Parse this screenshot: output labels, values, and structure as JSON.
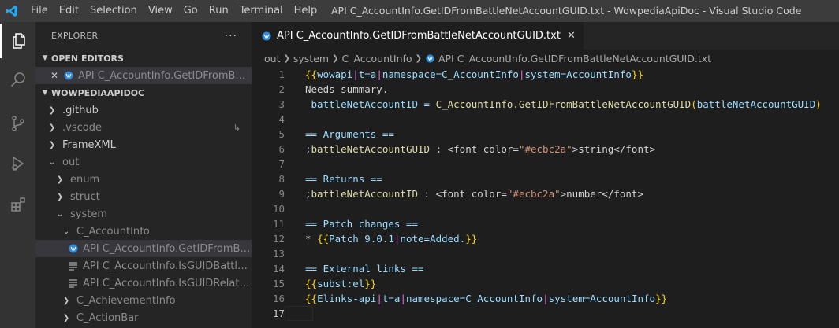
{
  "window": {
    "title": "API C_AccountInfo.GetIDFromBattleNetAccountGUID.txt - WowpediaApiDoc - Visual Studio Code",
    "accent_color": "#0098ff"
  },
  "menu": [
    "File",
    "Edit",
    "Selection",
    "View",
    "Go",
    "Run",
    "Terminal",
    "Help"
  ],
  "activity_bar": [
    {
      "name": "files-icon",
      "active": true
    },
    {
      "name": "search-icon",
      "active": false
    },
    {
      "name": "source-control-icon",
      "active": false
    },
    {
      "name": "run-debug-icon",
      "active": false
    },
    {
      "name": "extensions-icon",
      "active": false
    }
  ],
  "sidebar": {
    "title": "EXPLORER",
    "more": "···",
    "open_editors": {
      "label": "OPEN EDITORS",
      "items": [
        {
          "label": "API C_AccountInfo.GetIDFromBattleNetAccountGUID.txt",
          "icon": "wow-file-icon"
        }
      ]
    },
    "workspace": {
      "label": "WOWPEDIAAPIDOC",
      "tree": [
        {
          "label": ".github",
          "depth": 0,
          "twisty": "closed",
          "dim": false
        },
        {
          "label": ".vscode",
          "depth": 0,
          "twisty": "closed",
          "dim": true,
          "badge": "↳"
        },
        {
          "label": "FrameXML",
          "depth": 0,
          "twisty": "closed",
          "dim": false
        },
        {
          "label": "out",
          "depth": 0,
          "twisty": "open",
          "dim": true
        },
        {
          "label": "enum",
          "depth": 1,
          "twisty": "closed",
          "dim": true
        },
        {
          "label": "struct",
          "depth": 1,
          "twisty": "closed",
          "dim": true
        },
        {
          "label": "system",
          "depth": 1,
          "twisty": "open",
          "dim": true
        },
        {
          "label": "C_AccountInfo",
          "depth": 2,
          "twisty": "open",
          "dim": true
        },
        {
          "label": "API C_AccountInfo.GetIDFromBattleNetAccountGUID.txt",
          "depth": 3,
          "twisty": "none",
          "dim": true,
          "selected": true,
          "icon": "wow-file-icon"
        },
        {
          "label": "API C_AccountInfo.IsGUIDBattleNetAccountType.txt",
          "depth": 3,
          "twisty": "none",
          "dim": true,
          "icon": "text-file-icon"
        },
        {
          "label": "API C_AccountInfo.IsGUIDRelatedToLocalAccount.txt",
          "depth": 3,
          "twisty": "none",
          "dim": true,
          "icon": "text-file-icon"
        },
        {
          "label": "C_AchievementInfo",
          "depth": 2,
          "twisty": "closed",
          "dim": true
        },
        {
          "label": "C_ActionBar",
          "depth": 2,
          "twisty": "closed",
          "dim": true
        }
      ]
    }
  },
  "editor": {
    "tab": {
      "label": "API C_AccountInfo.GetIDFromBattleNetAccountGUID.txt",
      "close": "✕"
    },
    "breadcrumb": [
      "out",
      "system",
      "C_AccountInfo",
      "API C_AccountInfo.GetIDFromBattleNetAccountGUID.txt"
    ],
    "lines": [
      {
        "n": "1",
        "tokens": [
          [
            "{{",
            "c-brace-y"
          ],
          [
            "wowapi",
            "c-tpl"
          ],
          [
            "|",
            "c-brace-p"
          ],
          [
            "t=a",
            "c-tpl"
          ],
          [
            "|",
            "c-brace-p"
          ],
          [
            "namespace=C_AccountInfo",
            "c-tpl"
          ],
          [
            "|",
            "c-brace-p"
          ],
          [
            "system=AccountInfo",
            "c-tpl"
          ],
          [
            "}}",
            "c-brace-y"
          ]
        ]
      },
      {
        "n": "2",
        "tokens": [
          [
            "Needs summary.",
            "c-text"
          ]
        ]
      },
      {
        "n": "3",
        "tokens": [
          [
            " battleNetAccountID = ",
            "c-tpl"
          ],
          [
            "C_AccountInfo.GetIDFromBattleNetAccountGUID",
            "c-fn"
          ],
          [
            "(",
            "c-brace-y"
          ],
          [
            "battleNetAccountGUID",
            "c-tpl"
          ],
          [
            ")",
            "c-brace-y"
          ]
        ]
      },
      {
        "n": "4",
        "tokens": [
          [
            " ",
            "c-text"
          ]
        ]
      },
      {
        "n": "5",
        "tokens": [
          [
            "== Arguments ==",
            "c-tpl"
          ]
        ]
      },
      {
        "n": "6",
        "tokens": [
          [
            ";",
            "c-text"
          ],
          [
            "battleNetAccountGUID",
            "c-fn"
          ],
          [
            " : ",
            "c-text"
          ],
          [
            "<font color=",
            "c-text"
          ],
          [
            "\"#ecbc2a\"",
            "c-str"
          ],
          [
            ">string</font>",
            "c-text"
          ]
        ]
      },
      {
        "n": "7",
        "tokens": [
          [
            " ",
            "c-text"
          ]
        ]
      },
      {
        "n": "8",
        "tokens": [
          [
            "== Returns ==",
            "c-tpl"
          ]
        ]
      },
      {
        "n": "9",
        "tokens": [
          [
            ";",
            "c-text"
          ],
          [
            "battleNetAccountID",
            "c-fn"
          ],
          [
            " : ",
            "c-text"
          ],
          [
            "<font color=",
            "c-text"
          ],
          [
            "\"#ecbc2a\"",
            "c-str"
          ],
          [
            ">number</font>",
            "c-text"
          ]
        ]
      },
      {
        "n": "10",
        "tokens": [
          [
            " ",
            "c-text"
          ]
        ]
      },
      {
        "n": "11",
        "tokens": [
          [
            "== Patch changes ==",
            "c-tpl"
          ]
        ]
      },
      {
        "n": "12",
        "tokens": [
          [
            "* ",
            "c-text"
          ],
          [
            "{{",
            "c-brace-y"
          ],
          [
            "Patch 9.0.1",
            "c-tpl"
          ],
          [
            "|",
            "c-brace-p"
          ],
          [
            "note=Added.",
            "c-tpl"
          ],
          [
            "}}",
            "c-brace-y"
          ]
        ]
      },
      {
        "n": "13",
        "tokens": [
          [
            " ",
            "c-text"
          ]
        ]
      },
      {
        "n": "14",
        "tokens": [
          [
            "== External links ==",
            "c-tpl"
          ]
        ]
      },
      {
        "n": "15",
        "tokens": [
          [
            "{{",
            "c-brace-y"
          ],
          [
            "subst:el",
            "c-tpl"
          ],
          [
            "}}",
            "c-brace-y"
          ]
        ]
      },
      {
        "n": "16",
        "tokens": [
          [
            "{{",
            "c-brace-y"
          ],
          [
            "Elinks-api",
            "c-tpl"
          ],
          [
            "|",
            "c-brace-p"
          ],
          [
            "t=a",
            "c-tpl"
          ],
          [
            "|",
            "c-brace-p"
          ],
          [
            "namespace=C_AccountInfo",
            "c-tpl"
          ],
          [
            "|",
            "c-brace-p"
          ],
          [
            "system=AccountInfo",
            "c-tpl"
          ],
          [
            "}}",
            "c-brace-y"
          ]
        ]
      },
      {
        "n": "17",
        "tokens": [
          [
            " ",
            "c-text"
          ]
        ],
        "cursor": true
      }
    ]
  }
}
